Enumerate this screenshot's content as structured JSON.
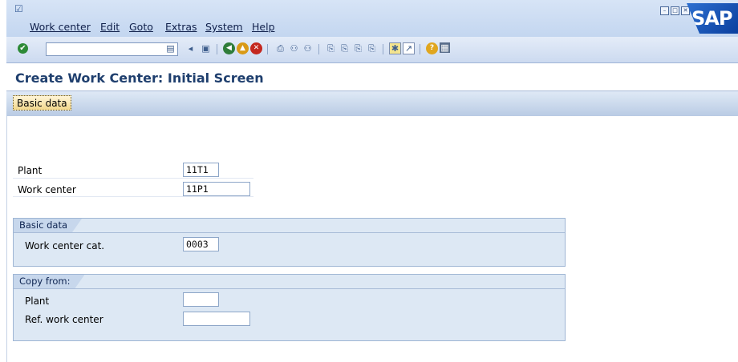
{
  "menu": {
    "items": [
      "Work center",
      "Edit",
      "Goto",
      "Extras",
      "System",
      "Help"
    ]
  },
  "logo": "SAP",
  "toolbar": {
    "icons": [
      "enter-icon",
      "save-icon",
      "back-icon",
      "exit-icon",
      "cancel-icon",
      "print-icon",
      "find-icon",
      "find-next-icon",
      "first-page-icon",
      "previous-page-icon",
      "next-page-icon",
      "last-page-icon",
      "create-session-icon",
      "shortcut-icon",
      "help-icon",
      "layout-icon"
    ]
  },
  "title": "Create Work Center: Initial Screen",
  "app_toolbar": {
    "basic_data_label": "Basic data"
  },
  "form": {
    "plant_label": "Plant",
    "plant_value": "11T1",
    "work_center_label": "Work center",
    "work_center_value": "11P1"
  },
  "basic_data_group": {
    "title": "Basic data",
    "work_center_cat_label": "Work center cat.",
    "work_center_cat_value": "0003"
  },
  "copy_from_group": {
    "title": "Copy from:",
    "plant_label": "Plant",
    "plant_value": "",
    "ref_work_center_label": "Ref. work center",
    "ref_work_center_value": ""
  }
}
